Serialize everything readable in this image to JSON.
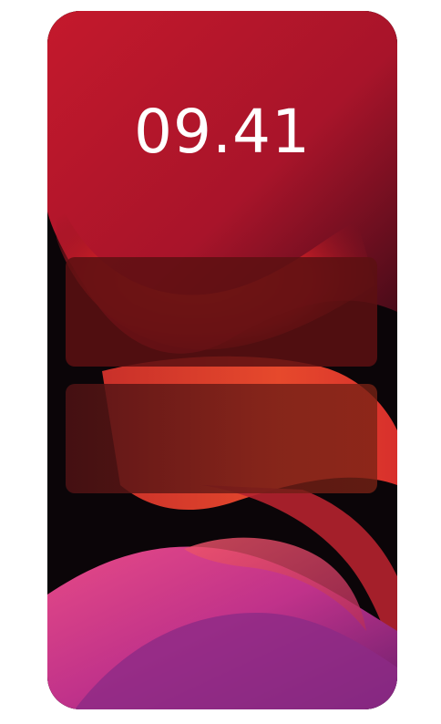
{
  "lock_screen": {
    "time": "09.41",
    "notifications": [
      {
        "id": "notification-1"
      },
      {
        "id": "notification-2"
      }
    ],
    "wallpaper": {
      "primary_color": "#c01c2a",
      "accent_color": "#e03a3a",
      "shadow_color": "#0b0508",
      "wave_color": "#d84ba0"
    }
  }
}
